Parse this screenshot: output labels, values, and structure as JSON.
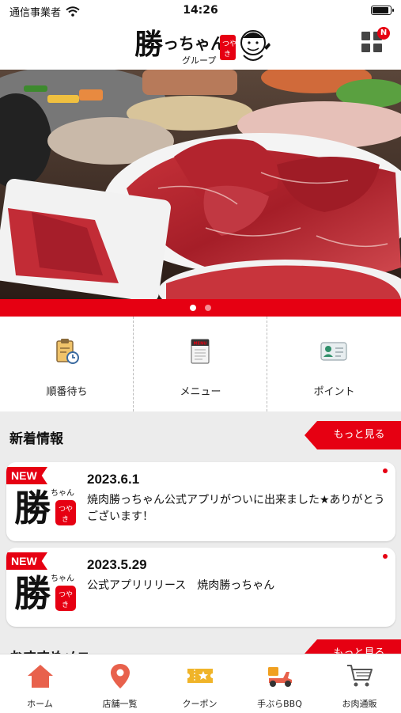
{
  "status_bar": {
    "carrier": "通信事業者",
    "time": "14:26"
  },
  "header": {
    "logo_text": "勝っちゃん",
    "logo_sub": "グループ",
    "logo_badge": "つやき",
    "menu_badge": "N"
  },
  "hero": {
    "slide_index": 1,
    "slide_count": 2
  },
  "quick_menu": [
    {
      "label": "順番待ち",
      "icon": "clipboard-clock-icon"
    },
    {
      "label": "メニュー",
      "icon": "menu-book-icon"
    },
    {
      "label": "ポイント",
      "icon": "member-card-icon"
    }
  ],
  "news": {
    "title": "新着情報",
    "more_label": "もっと見る",
    "items": [
      {
        "badge": "NEW",
        "date": "2023.6.1",
        "text": "焼肉勝っちゃん公式アプリがついに出来ました★ありがとうございます！",
        "unread": true
      },
      {
        "badge": "NEW",
        "date": "2023.5.29",
        "text": "公式アプリリリース　焼肉勝っちゃん",
        "unread": true
      }
    ]
  },
  "recommended": {
    "title": "おすすめメニュー",
    "more_label": "もっと見る"
  },
  "tab_bar": [
    {
      "label": "ホーム",
      "icon": "home-icon"
    },
    {
      "label": "店舗一覧",
      "icon": "map-pin-icon"
    },
    {
      "label": "クーポン",
      "icon": "coupon-ticket-icon"
    },
    {
      "label": "手ぶらBBQ",
      "icon": "delivery-scooter-icon"
    },
    {
      "label": "お肉通販",
      "icon": "shopping-cart-icon"
    }
  ],
  "colors": {
    "brand_red": "#e60012",
    "background_gray": "#ececec"
  }
}
